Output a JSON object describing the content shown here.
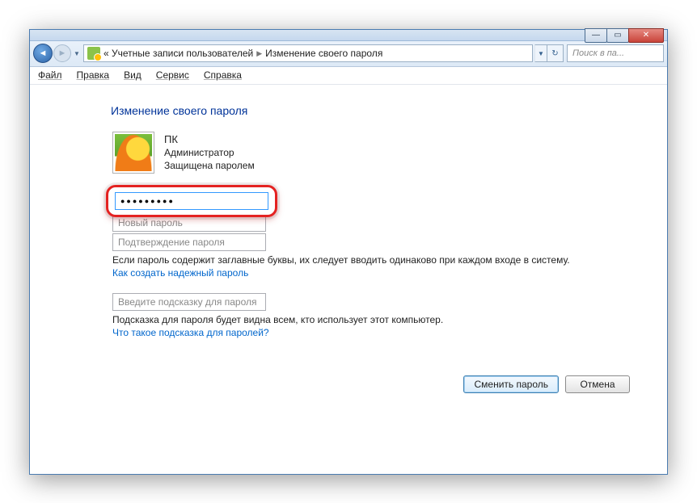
{
  "title_buttons": {
    "min": "—",
    "max": "▭",
    "close": "✕"
  },
  "breadcrumb": {
    "prefix": "«",
    "level1": "Учетные записи пользователей",
    "level2": "Изменение своего пароля"
  },
  "search": {
    "placeholder": "Поиск в па..."
  },
  "menu": {
    "file": "Файл",
    "edit": "Правка",
    "view": "Вид",
    "tools": "Сервис",
    "help": "Справка"
  },
  "page": {
    "title": "Изменение своего пароля",
    "user": {
      "name": "ПК",
      "role": "Администратор",
      "status": "Защищена паролем"
    },
    "fields": {
      "current_masked": "●●●●●●●●●",
      "new_placeholder": "Новый пароль",
      "confirm_placeholder": "Подтверждение пароля",
      "hint_placeholder": "Введите подсказку для пароля"
    },
    "caps_note": "Если пароль содержит заглавные буквы, их следует вводить одинаково при каждом входе в систему.",
    "help1": "Как создать надежный пароль",
    "hint_note": "Подсказка для пароля будет видна всем, кто использует этот компьютер.",
    "help2": "Что такое подсказка для паролей?",
    "buttons": {
      "submit": "Сменить пароль",
      "cancel": "Отмена"
    }
  }
}
